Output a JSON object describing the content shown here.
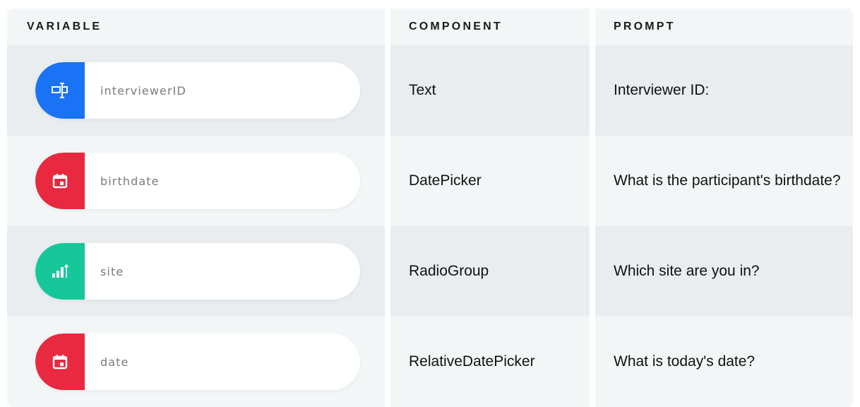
{
  "headers": {
    "variable": "VARIABLE",
    "component": "COMPONENT",
    "prompt": "PROMPT"
  },
  "rows": [
    {
      "variable": "interviewerID",
      "icon": "text-input-icon",
      "icon_color": "#1a73f5",
      "component": "Text",
      "prompt": "Interviewer ID:"
    },
    {
      "variable": "birthdate",
      "icon": "calendar-icon",
      "icon_color": "#e8293f",
      "component": "DatePicker",
      "prompt": "What is the participant's birthdate?"
    },
    {
      "variable": "site",
      "icon": "ordinal-scale-icon",
      "icon_color": "#16c79a",
      "component": "RadioGroup",
      "prompt": "Which site are you in?"
    },
    {
      "variable": "date",
      "icon": "calendar-icon",
      "icon_color": "#e8293f",
      "component": "RelativeDatePicker",
      "prompt": "What is today's date?"
    }
  ]
}
